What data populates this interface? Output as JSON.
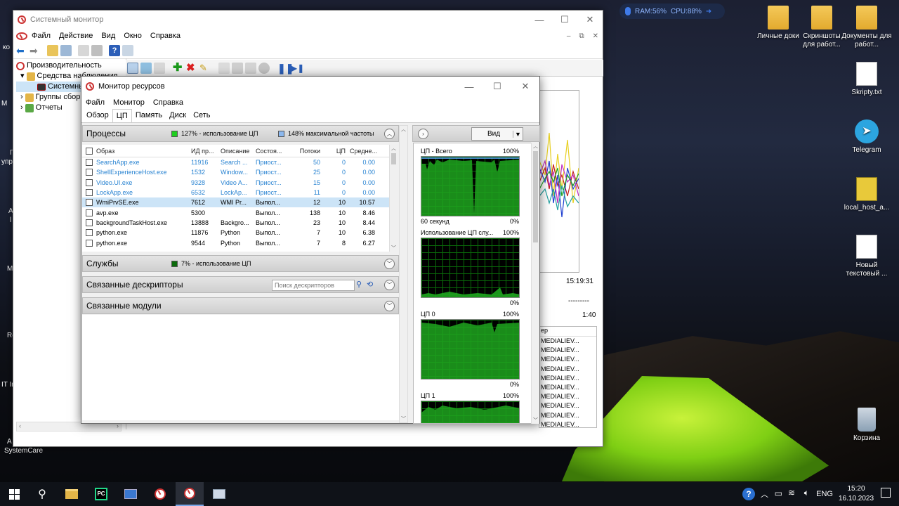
{
  "desktop": {
    "gadget": {
      "ram": "RAM:56%",
      "cpu": "CPU:88%"
    },
    "icons": [
      {
        "label": "Личные доки",
        "icon": "folder-icon"
      },
      {
        "label": "Скриншоты для работ...",
        "icon": "folder-icon"
      },
      {
        "label": "Документы для работ...",
        "icon": "folder-icon"
      },
      {
        "label": "Skripty.txt",
        "icon": "text-file-icon"
      },
      {
        "label": "Telegram",
        "icon": "telegram-icon"
      },
      {
        "label": "local_host_a...",
        "icon": "archive-icon"
      },
      {
        "label": "Новый текстовый ...",
        "icon": "text-file-icon"
      },
      {
        "label": "Корзина",
        "icon": "recycle-bin-icon"
      }
    ],
    "left_partial": [
      "ко",
      "М",
      "П",
      "упр",
      "А",
      "l",
      "М",
      "Re",
      "IT In",
      "A",
      "SystemCare"
    ]
  },
  "sysmon": {
    "title": "Системный монитор",
    "menu": [
      "Файл",
      "Действие",
      "Вид",
      "Окно",
      "Справка"
    ],
    "tree": [
      "Производительность",
      "Средства наблюдения",
      "Системный",
      "Группы сборщ",
      "Отчеты"
    ],
    "graph_time": "15:19:31",
    "graph_dash": "---------",
    "graph_duration": "1:40",
    "user_col_header": "ер",
    "user_rows": [
      "MEDIALIEV...",
      "MEDIALIEV...",
      "MEDIALIEV...",
      "MEDIALIEV...",
      "MEDIALIEV...",
      "MEDIALIEV...",
      "MEDIALIEV...",
      "MEDIALIEV...",
      "MEDIALIEV...",
      "MEDIALIEV..."
    ]
  },
  "resmon": {
    "title": "Монитор ресурсов",
    "menu": [
      "Файл",
      "Монитор",
      "Справка"
    ],
    "tabs": [
      "Обзор",
      "ЦП",
      "Память",
      "Диск",
      "Сеть"
    ],
    "processes": {
      "title": "Процессы",
      "usage": "127% - использование ЦП",
      "maxfreq": "148% максимальной частоты",
      "columns": [
        "Образ",
        "ИД пр...",
        "Описание",
        "Состоя...",
        "Потоки",
        "ЦП",
        "Средне..."
      ],
      "rows": [
        [
          "SearchApp.exe",
          "11916",
          "Search ...",
          "Приост...",
          "50",
          "0",
          "0.00"
        ],
        [
          "ShellExperienceHost.exe",
          "1532",
          "Window...",
          "Приост...",
          "25",
          "0",
          "0.00"
        ],
        [
          "Video.UI.exe",
          "9328",
          "Video A...",
          "Приост...",
          "15",
          "0",
          "0.00"
        ],
        [
          "LockApp.exe",
          "6532",
          "LockAp...",
          "Приост...",
          "11",
          "0",
          "0.00"
        ],
        [
          "WmiPrvSE.exe",
          "7612",
          "WMI Pr...",
          "Выпол...",
          "12",
          "10",
          "10.57"
        ],
        [
          "avp.exe",
          "5300",
          "",
          "Выпол...",
          "138",
          "10",
          "8.46"
        ],
        [
          "backgroundTaskHost.exe",
          "13888",
          "Backgro...",
          "Выпол...",
          "23",
          "10",
          "8.44"
        ],
        [
          "python.exe",
          "11876",
          "Python",
          "Выпол...",
          "7",
          "10",
          "6.38"
        ],
        [
          "python.exe",
          "9544",
          "Python",
          "Выпол...",
          "7",
          "8",
          "6.27"
        ]
      ]
    },
    "services": {
      "title": "Службы",
      "usage": "7% - использование ЦП"
    },
    "handles": {
      "title": "Связанные дескрипторы",
      "search_placeholder": "Поиск дескрипторов"
    },
    "modules": {
      "title": "Связанные модули"
    },
    "view_button": "Вид",
    "graphs": [
      {
        "label": "ЦП - Всего",
        "max": "100%",
        "foot_left": "60 секунд",
        "foot_right": "0%"
      },
      {
        "label": "Использование ЦП слу...",
        "max": "100%",
        "foot_left": "",
        "foot_right": "0%"
      },
      {
        "label": "ЦП 0",
        "max": "100%",
        "foot_left": "",
        "foot_right": "0%"
      },
      {
        "label": "ЦП 1",
        "max": "100%",
        "foot_left": "",
        "foot_right": ""
      }
    ]
  },
  "taskbar": {
    "lang": "ENG",
    "time": "15:20",
    "date": "16.10.2023"
  }
}
